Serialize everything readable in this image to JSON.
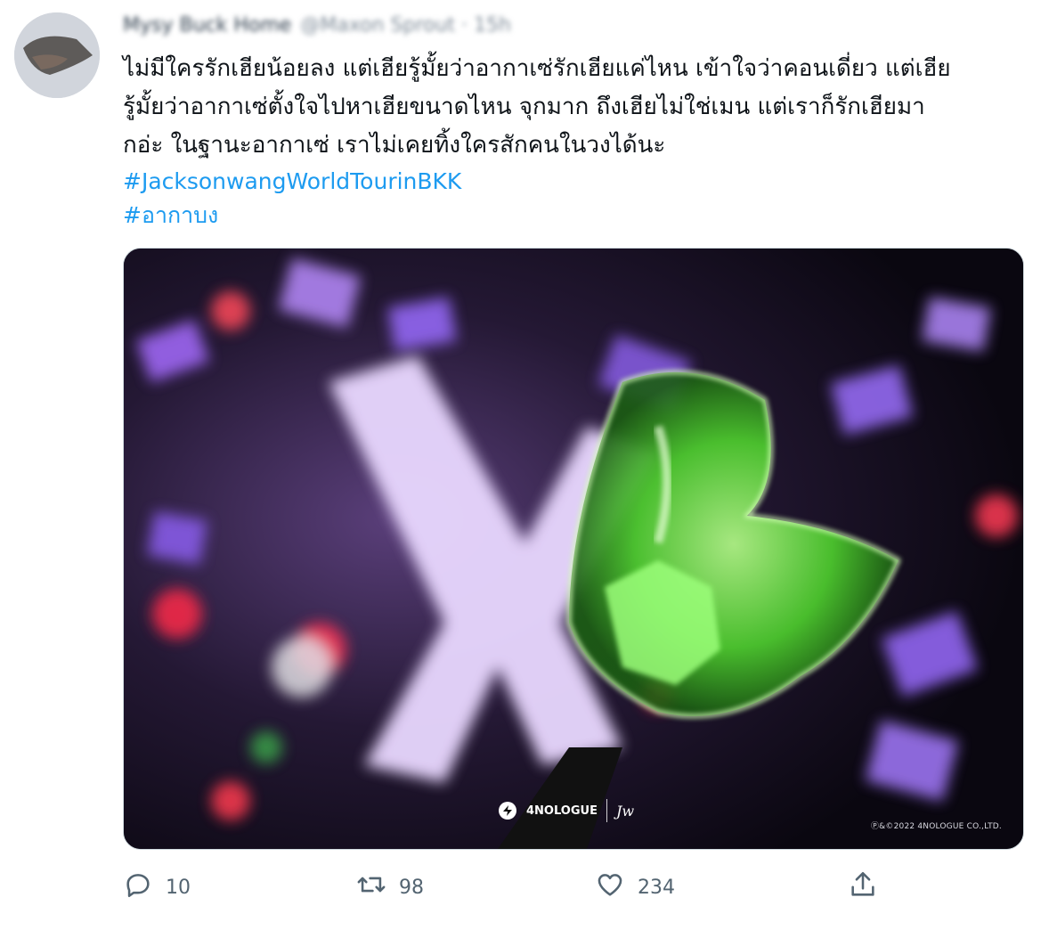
{
  "author": {
    "display_name": "Mysy Buck Home",
    "handle": "@Maxon Sprout · 15h"
  },
  "tweet": {
    "text_lines": [
      "ไม่มีใครรักเฮียน้อยลง แต่เฮียรู้มั้ยว่าอากาเซ่รักเฮียแค่ไหน เข้าใจว่าคอนเดี่ยว แต่เฮีย",
      "รู้มั้ยว่าอากาเซ่ตั้งใจไปหาเฮียขนาดไหน จุกมาก ถึงเฮียไม่ใช่เมน แต่เราก็รักเฮียมา",
      "กอ่ะ ในฐานะอากาเซ่ เราไม่เคยทิ้งใครสักคนในวงได้นะ"
    ],
    "hashtags": [
      "#JacksonwangWorldTourinBKK",
      "#อากาบง"
    ]
  },
  "media": {
    "brand_text": "4NOLOGUE",
    "signature": "Jw",
    "copyright": "Ⓟ&©2022 4NOLOGUE CO.,LTD."
  },
  "actions": {
    "reply_count": "10",
    "retweet_count": "98",
    "like_count": "234"
  },
  "colors": {
    "accent": "#1d9bf0",
    "secondary_text": "#536471",
    "lightstick_green": "#7dff5c"
  }
}
